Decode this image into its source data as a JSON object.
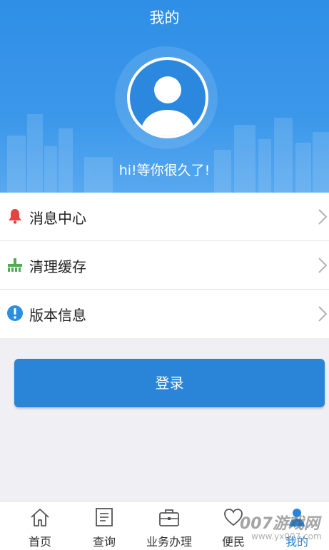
{
  "header": {
    "title": "我的",
    "greeting": "hi!等你很久了!",
    "avatar_icon": "user-silhouette-icon"
  },
  "menu": {
    "items": [
      {
        "label": "消息中心",
        "icon": "bell-icon",
        "icon_color": "#e64340"
      },
      {
        "label": "清理缓存",
        "icon": "broom-icon",
        "icon_color": "#4caf50"
      },
      {
        "label": "版本信息",
        "icon": "info-icon",
        "icon_color": "#2a8fe0"
      }
    ]
  },
  "login": {
    "label": "登录"
  },
  "tabbar": {
    "tabs": [
      {
        "label": "首页",
        "icon": "home-icon"
      },
      {
        "label": "查询",
        "icon": "document-icon"
      },
      {
        "label": "业务办理",
        "icon": "briefcase-icon"
      },
      {
        "label": "便民",
        "icon": "heart-icon"
      },
      {
        "label": "我的",
        "icon": "user-icon",
        "active": true
      }
    ]
  },
  "watermark": {
    "text": "007游戏网",
    "url": "www.yx007.com"
  },
  "colors": {
    "header_blue": "#2f8ee6",
    "button_blue": "#2a85d8",
    "background": "#efeff4"
  }
}
